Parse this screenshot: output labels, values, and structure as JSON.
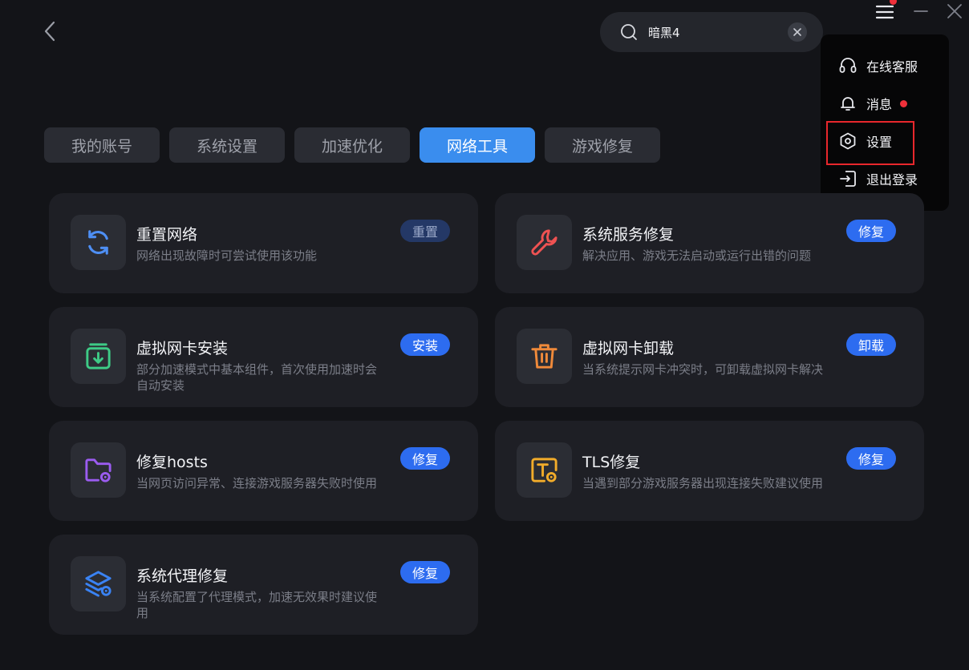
{
  "search": {
    "value": "暗黑4"
  },
  "menu": {
    "items": [
      {
        "icon": "headset-icon",
        "label": "在线客服"
      },
      {
        "icon": "bell-icon",
        "label": "消息"
      },
      {
        "icon": "settings-hexagon-icon",
        "label": "设置"
      },
      {
        "icon": "logout-icon",
        "label": "退出登录"
      }
    ],
    "highlighted_item": "设置"
  },
  "tabs": [
    {
      "label": "我的账号",
      "active": false
    },
    {
      "label": "系统设置",
      "active": false
    },
    {
      "label": "加速优化",
      "active": false
    },
    {
      "label": "网络工具",
      "active": true
    },
    {
      "label": "游戏修复",
      "active": false
    }
  ],
  "tools": [
    {
      "icon": "refresh-icon",
      "title": "重置网络",
      "desc": "网络出现故障时可尝试使用该功能",
      "action": "重置"
    },
    {
      "icon": "wrench-icon",
      "title": "系统服务修复",
      "desc": "解决应用、游戏无法启动或运行出错的问题",
      "action": "修复"
    },
    {
      "icon": "download-box-icon",
      "title": "虚拟网卡安装",
      "desc": "部分加速模式中基本组件，首次使用加速时会自动安装",
      "action": "安装"
    },
    {
      "icon": "trash-icon",
      "title": "虚拟网卡卸载",
      "desc": "当系统提示网卡冲突时，可卸载虚拟网卡解决",
      "action": "卸载"
    },
    {
      "icon": "folder-gear-icon",
      "title": "修复hosts",
      "desc": "当网页访问异常、连接游戏服务器失败时使用",
      "action": "修复"
    },
    {
      "icon": "tls-gear-icon",
      "title": "TLS修复",
      "desc": "当遇到部分游戏服务器出现连接失败建议使用",
      "action": "修复"
    },
    {
      "icon": "layers-gear-icon",
      "title": "系统代理修复",
      "desc": "当系统配置了代理模式，加速无效果时建议使用",
      "action": "修复"
    }
  ],
  "colors": {
    "background": "#131418",
    "card": "#1e1f25",
    "accent": "#3a8dee",
    "action_button": "#2d6cf0",
    "highlight": "#e8272c",
    "notification": "#f0303a"
  }
}
